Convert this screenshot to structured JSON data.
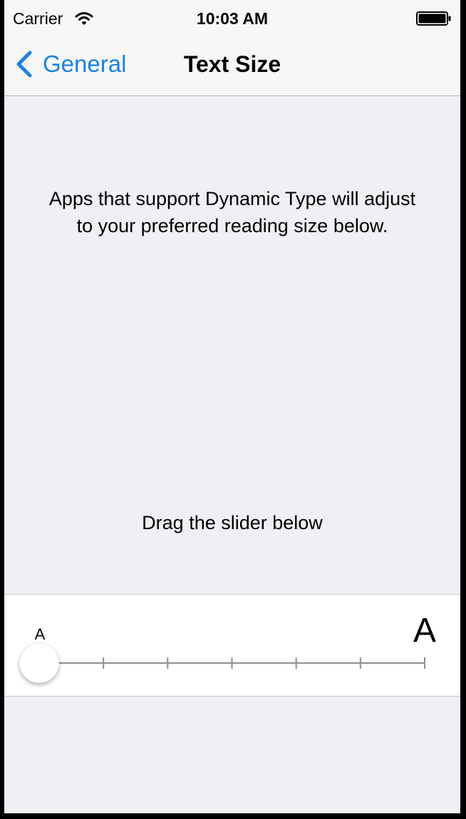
{
  "status_bar": {
    "carrier": "Carrier",
    "time": "10:03 AM",
    "wifi_icon": "wifi-icon",
    "battery_icon": "battery-icon"
  },
  "nav": {
    "back_label": "General",
    "back_icon": "chevron-left-icon",
    "title": "Text Size"
  },
  "content": {
    "description": "Apps that support Dynamic Type will adjust to your preferred reading size below.",
    "instruction": "Drag the slider below"
  },
  "slider": {
    "small_label": "A",
    "large_label": "A",
    "steps": 7,
    "selected_step": 1
  },
  "colors": {
    "accent": "#1a82e2",
    "background": "#efeff4",
    "track": "#8e8e93"
  }
}
